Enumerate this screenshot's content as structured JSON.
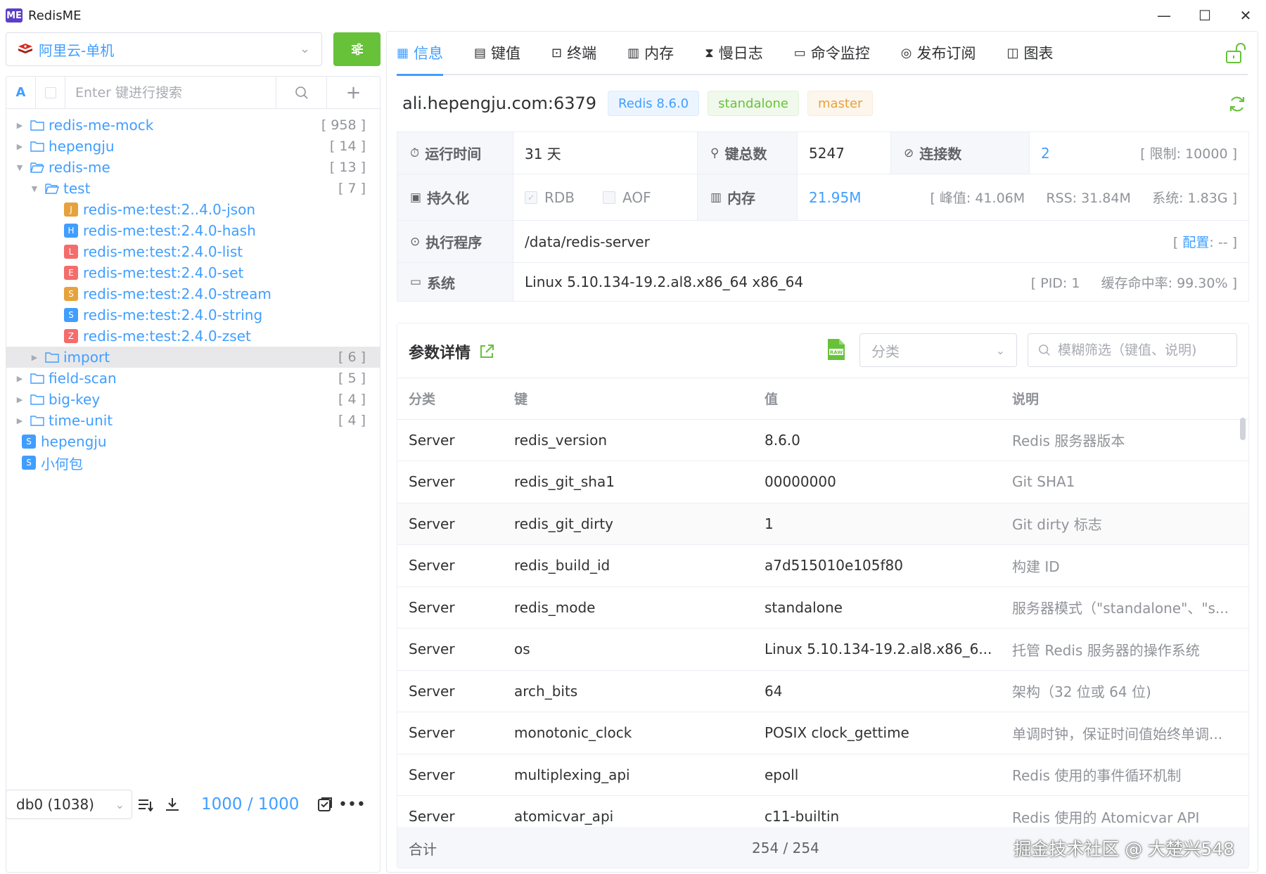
{
  "app": {
    "logo": "ME",
    "title": "RedisME"
  },
  "window_controls": {
    "minimize": "—",
    "maximize": "☐",
    "close": "✕"
  },
  "connection": {
    "selected": "阿里云-单机",
    "icon": "redis-icon"
  },
  "search": {
    "mode": "A",
    "placeholder": "Enter 键进行搜索"
  },
  "tree": [
    {
      "type": "folder",
      "label": "redis-me-mock",
      "count": "[ 958 ]",
      "level": 0,
      "expanded": false
    },
    {
      "type": "folder",
      "label": "hepengju",
      "count": "[ 14 ]",
      "level": 0,
      "expanded": false
    },
    {
      "type": "folder",
      "label": "redis-me",
      "count": "[ 13 ]",
      "level": 0,
      "expanded": true
    },
    {
      "type": "folder",
      "label": "test",
      "count": "[ 7 ]",
      "level": 1,
      "expanded": true
    },
    {
      "type": "key",
      "badge": "J",
      "color": "#e6a23c",
      "label": "redis-me:test:2..4.0-json",
      "level": 2
    },
    {
      "type": "key",
      "badge": "H",
      "color": "#409eff",
      "label": "redis-me:test:2.4.0-hash",
      "level": 2
    },
    {
      "type": "key",
      "badge": "L",
      "color": "#f56c6c",
      "label": "redis-me:test:2.4.0-list",
      "level": 2
    },
    {
      "type": "key",
      "badge": "E",
      "color": "#f56c6c",
      "label": "redis-me:test:2.4.0-set",
      "level": 2
    },
    {
      "type": "key",
      "badge": "S",
      "color": "#e6a23c",
      "label": "redis-me:test:2.4.0-stream",
      "level": 2
    },
    {
      "type": "key",
      "badge": "S",
      "color": "#409eff",
      "label": "redis-me:test:2.4.0-string",
      "level": 2
    },
    {
      "type": "key",
      "badge": "Z",
      "color": "#f56c6c",
      "label": "redis-me:test:2.4.0-zset",
      "level": 2
    },
    {
      "type": "folder",
      "label": "import",
      "count": "[ 6 ]",
      "level": 1,
      "expanded": false,
      "selected": true
    },
    {
      "type": "folder",
      "label": "field-scan",
      "count": "[ 5 ]",
      "level": 0,
      "expanded": false
    },
    {
      "type": "folder",
      "label": "big-key",
      "count": "[ 4 ]",
      "level": 0,
      "expanded": false
    },
    {
      "type": "folder",
      "label": "time-unit",
      "count": "[ 4 ]",
      "level": 0,
      "expanded": false
    },
    {
      "type": "key",
      "badge": "S",
      "color": "#409eff",
      "label": "hepengju",
      "level": 0
    },
    {
      "type": "key",
      "badge": "S",
      "color": "#409eff",
      "label": "小何包",
      "level": 0
    }
  ],
  "bottom": {
    "db": "db0 (1038)",
    "page_count": "1000 / 1000"
  },
  "tabs": [
    {
      "label": "信息",
      "icon": "calendar-icon",
      "glyph": "▦",
      "active": true
    },
    {
      "label": "键值",
      "icon": "document-icon",
      "glyph": "▤",
      "active": false
    },
    {
      "label": "终端",
      "icon": "terminal-icon",
      "glyph": "⊡",
      "active": false
    },
    {
      "label": "内存",
      "icon": "memory-icon",
      "glyph": "▥",
      "active": false
    },
    {
      "label": "慢日志",
      "icon": "hourglass-icon",
      "glyph": "⧗",
      "active": false
    },
    {
      "label": "命令监控",
      "icon": "monitor-icon",
      "glyph": "▭",
      "active": false
    },
    {
      "label": "发布订阅",
      "icon": "broadcast-icon",
      "glyph": "◎",
      "active": false
    },
    {
      "label": "图表",
      "icon": "chart-icon",
      "glyph": "◫",
      "active": false
    }
  ],
  "server": {
    "host": "ali.hepengju.com:6379",
    "version_tag": "Redis 8.6.0",
    "mode_tag": "standalone",
    "role_tag": "master"
  },
  "info": {
    "uptime_label": "运行时间",
    "uptime_value": "31 天",
    "keys_label": "键总数",
    "keys_value": "5247",
    "conn_label": "连接数",
    "conn_value": "2",
    "conn_limit": "[ 限制: 10000 ]",
    "persist_label": "持久化",
    "rdb": "RDB",
    "aof": "AOF",
    "mem_label": "内存",
    "mem_value": "21.95M",
    "mem_detail": "[ 峰值: 41.06M     RSS: 31.84M     系统: 1.83G ]",
    "exec_label": "执行程序",
    "exec_value": "/data/redis-server",
    "config_prefix": "[ ",
    "config_link": "配置",
    "config_suffix": ": -- ]",
    "sys_label": "系统",
    "sys_value": "Linux 5.10.134-19.2.al8.x86_64 x86_64",
    "sys_detail": "[ PID: 1     缓存命中率: 99.30% ]"
  },
  "params": {
    "title": "参数详情",
    "category_placeholder": "分类",
    "filter_placeholder": "模糊筛选（键值、说明)",
    "columns": [
      "分类",
      "键",
      "值",
      "说明"
    ],
    "rows": [
      [
        "Server",
        "redis_version",
        "8.6.0",
        "Redis 服务器版本"
      ],
      [
        "Server",
        "redis_git_sha1",
        "00000000",
        "Git SHA1"
      ],
      [
        "Server",
        "redis_git_dirty",
        "1",
        "Git dirty 标志"
      ],
      [
        "Server",
        "redis_build_id",
        "a7d515010e105f80",
        "构建 ID"
      ],
      [
        "Server",
        "redis_mode",
        "standalone",
        "服务器模式（\"standalone\"、\"s..."
      ],
      [
        "Server",
        "os",
        "Linux 5.10.134-19.2.al8.x86_6...",
        "托管 Redis 服务器的操作系统"
      ],
      [
        "Server",
        "arch_bits",
        "64",
        "架构（32 位或 64 位)"
      ],
      [
        "Server",
        "monotonic_clock",
        "POSIX clock_gettime",
        "单调时钟，保证时间值始终单调..."
      ],
      [
        "Server",
        "multiplexing_api",
        "epoll",
        "Redis 使用的事件循环机制"
      ],
      [
        "Server",
        "atomicvar_api",
        "c11-builtin",
        "Redis 使用的 Atomicvar API"
      ]
    ],
    "sum_label": "合计",
    "sum_value": "254 / 254"
  },
  "watermark": "掘金技术社区 @ 大楚兴548"
}
